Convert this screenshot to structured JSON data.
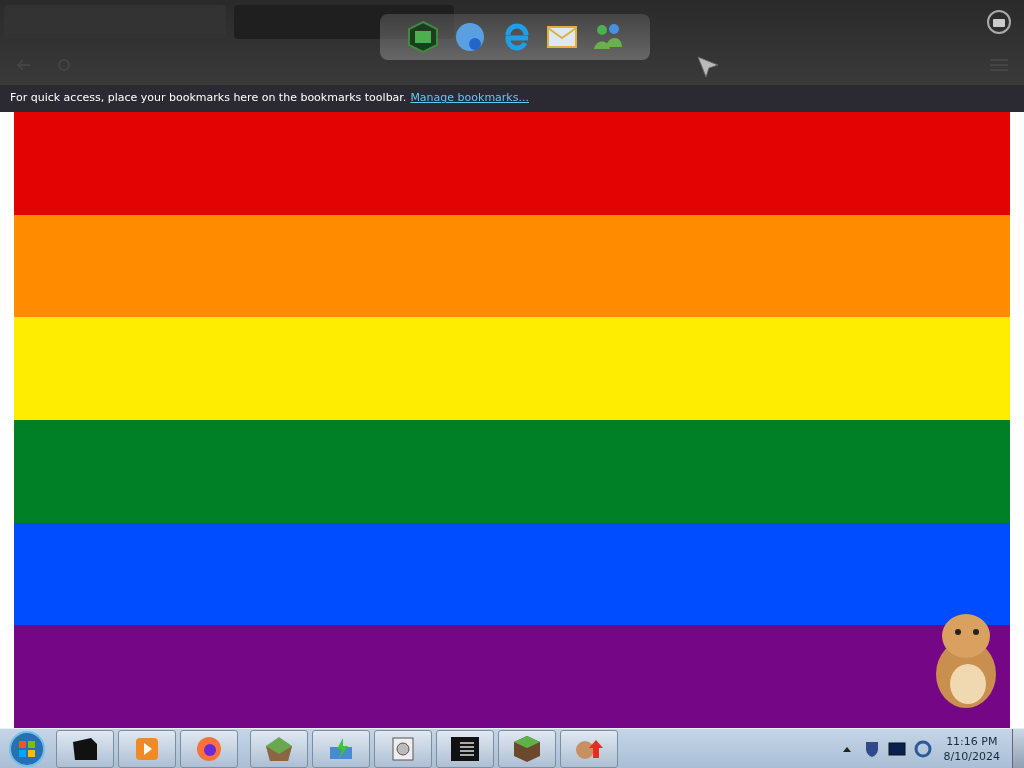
{
  "bookmarks_bar": {
    "message": "For quick access, place your bookmarks here on the bookmarks toolbar.",
    "link": "Manage bookmarks..."
  },
  "flag": {
    "stripes": [
      {
        "color": "#e40303"
      },
      {
        "color": "#ff8c00"
      },
      {
        "color": "#ffed00"
      },
      {
        "color": "#008026"
      },
      {
        "color": "#004dff"
      },
      {
        "color": "#750787"
      }
    ]
  },
  "clock": {
    "time": "11:16 PM",
    "date": "8/10/2024"
  }
}
